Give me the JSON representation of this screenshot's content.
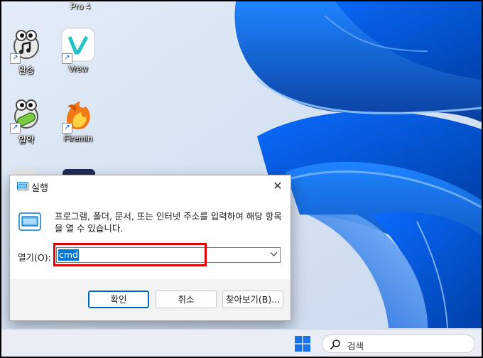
{
  "desktop": {
    "top_partial_label": "Pro 4",
    "icons": [
      {
        "name": "알송",
        "icon": "alsong-icon"
      },
      {
        "name": "Vrew",
        "icon": "vrew-icon"
      },
      {
        "name": "알약",
        "icon": "alyac-icon"
      },
      {
        "name": "Firemin",
        "icon": "firemin-icon"
      }
    ]
  },
  "dialog": {
    "title": "실행",
    "description": "프로그램, 폴더, 문서, 또는 인터넷 주소를 입력하여 해당 항목을 열 수 있습니다.",
    "open_label": "열기(O):",
    "input_value": "cmd",
    "buttons": {
      "ok": "확인",
      "cancel": "취소",
      "browse": "찾아보기(B)..."
    },
    "close_glyph": "✕",
    "highlight_color": "#e00000"
  },
  "taskbar": {
    "search_placeholder": "검색",
    "start_icon": "windows-logo-icon"
  },
  "colors": {
    "wallpaper_base": "#dbe6f3",
    "wallpaper_accent": "#0a5fd8",
    "selection": "#0078d7"
  }
}
